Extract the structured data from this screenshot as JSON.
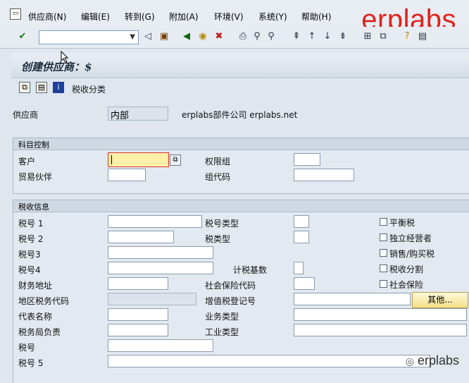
{
  "menu": {
    "items": [
      "供应商(N)",
      "编辑(E)",
      "转到(G)",
      "附加(A)",
      "环境(V)",
      "系统(Y)",
      "帮助(H)"
    ]
  },
  "brand": {
    "logo_text": "erplabs",
    "watermark": "erplabs"
  },
  "screen": {
    "title": "创建供应商：$"
  },
  "app_toolbar": {
    "tax_category_label": "税收分类"
  },
  "vendor": {
    "label": "供应商",
    "value": "内部",
    "name": "erplabs部件公司 erplabs.net"
  },
  "account_control": {
    "title": "科目控制",
    "customer_label": "客户",
    "trading_partner_label": "贸易伙伴",
    "authorization_label": "权限组",
    "group_key_label": "组代码"
  },
  "tax": {
    "title": "税收信息",
    "tax_no1": "税号 1",
    "tax_no2": "税号 2",
    "tax_no3": "税号3",
    "tax_no4": "税号4",
    "tax_office": "财务地址",
    "county_code": "地区税务代码",
    "rep_name": "代表名称",
    "tax_officer": "税务局负责",
    "tax_no": "税号",
    "tax_no5": "税号 5",
    "tax_type": "税号类型",
    "tax_category": "税类型",
    "tax_base": "计税基数",
    "social_ins_code": "社会保险代码",
    "vat_reg": "增值税登记号",
    "business_type": "业务类型",
    "industry_type": "工业类型",
    "other_button": "其他...",
    "checkboxes": [
      "平衡税",
      "独立经营者",
      "销售/购买税",
      "税收分割",
      "社会保险"
    ]
  },
  "colors": {
    "logo": "#e0231b",
    "required_field": "#fdf0a8",
    "background": "#dfe6ee"
  }
}
